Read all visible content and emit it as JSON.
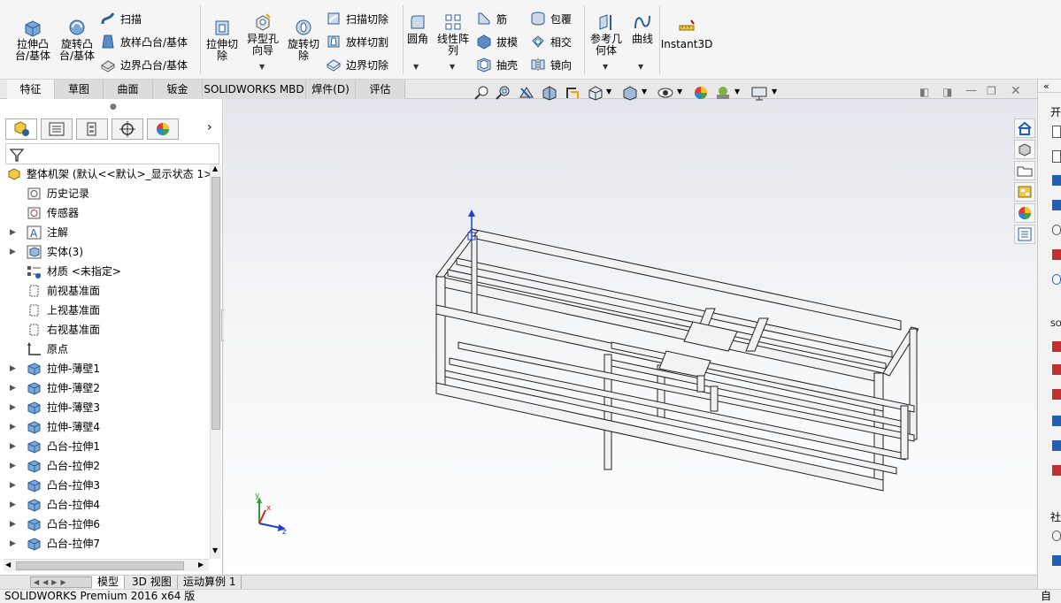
{
  "ribbon": {
    "extrude_boss": "拉伸凸\n台/基体",
    "revolve_boss": "旋转凸\n台/基体",
    "sweep": "扫描",
    "loft_boss": "放样凸台/基体",
    "boundary_boss": "边界凸台/基体",
    "extrude_cut": "拉伸切\n除",
    "hole_wizard": "异型孔\n向导",
    "revolve_cut": "旋转切\n除",
    "swept_cut": "扫描切除",
    "lofted_cut": "放样切割",
    "boundary_cut": "边界切除",
    "fillet": "圆角",
    "linear_pattern": "线性阵\n列",
    "rib": "筋",
    "draft": "拔模",
    "shell": "抽壳",
    "wrap": "包覆",
    "intersect": "相交",
    "mirror": "镜向",
    "reference_geometry": "参考几\n何体",
    "curves": "曲线",
    "instant3d": "Instant3D"
  },
  "tabs": [
    "特征",
    "草图",
    "曲面",
    "钣金",
    "SOLIDWORKS MBD",
    "焊件(D)",
    "评估"
  ],
  "tree": {
    "root": "整体机架  (默认<<默认>_显示状态 1>",
    "items": [
      {
        "label": "历史记录",
        "icon": "history-icon",
        "expandable": false
      },
      {
        "label": "传感器",
        "icon": "sensor-icon",
        "expandable": false
      },
      {
        "label": "注解",
        "icon": "annotation-icon",
        "expandable": true
      },
      {
        "label": "实体(3)",
        "icon": "solid-bodies-icon",
        "expandable": true
      },
      {
        "label": "材质 <未指定>",
        "icon": "material-icon",
        "expandable": false
      },
      {
        "label": "前视基准面",
        "icon": "plane-icon",
        "expandable": false
      },
      {
        "label": "上视基准面",
        "icon": "plane-icon",
        "expandable": false
      },
      {
        "label": "右视基准面",
        "icon": "plane-icon",
        "expandable": false
      },
      {
        "label": "原点",
        "icon": "origin-icon",
        "expandable": false
      },
      {
        "label": "拉伸-薄壁1",
        "icon": "extrude-feature-icon",
        "expandable": true
      },
      {
        "label": "拉伸-薄壁2",
        "icon": "extrude-feature-icon",
        "expandable": true
      },
      {
        "label": "拉伸-薄壁3",
        "icon": "extrude-feature-icon",
        "expandable": true
      },
      {
        "label": "拉伸-薄壁4",
        "icon": "extrude-feature-icon",
        "expandable": true
      },
      {
        "label": "凸台-拉伸1",
        "icon": "extrude-feature-icon",
        "expandable": true
      },
      {
        "label": "凸台-拉伸2",
        "icon": "extrude-feature-icon",
        "expandable": true
      },
      {
        "label": "凸台-拉伸3",
        "icon": "extrude-feature-icon",
        "expandable": true
      },
      {
        "label": "凸台-拉伸4",
        "icon": "extrude-feature-icon",
        "expandable": true
      },
      {
        "label": "凸台-拉伸6",
        "icon": "extrude-feature-icon",
        "expandable": true
      },
      {
        "label": "凸台-拉伸7",
        "icon": "extrude-feature-icon",
        "expandable": true
      }
    ]
  },
  "bottom_tabs": [
    "模型",
    "3D 视图",
    "运动算例 1"
  ],
  "status": {
    "text": "SOLIDWORKS Premium 2016 x64 版",
    "right_char": "自"
  },
  "triad": {
    "x": "x",
    "y": "y",
    "z": "z"
  },
  "right_edge_chars": [
    "开",
    "SO",
    "社"
  ],
  "colors": {
    "accent": "#1f5fb4",
    "frame": "#c8c8c8"
  }
}
